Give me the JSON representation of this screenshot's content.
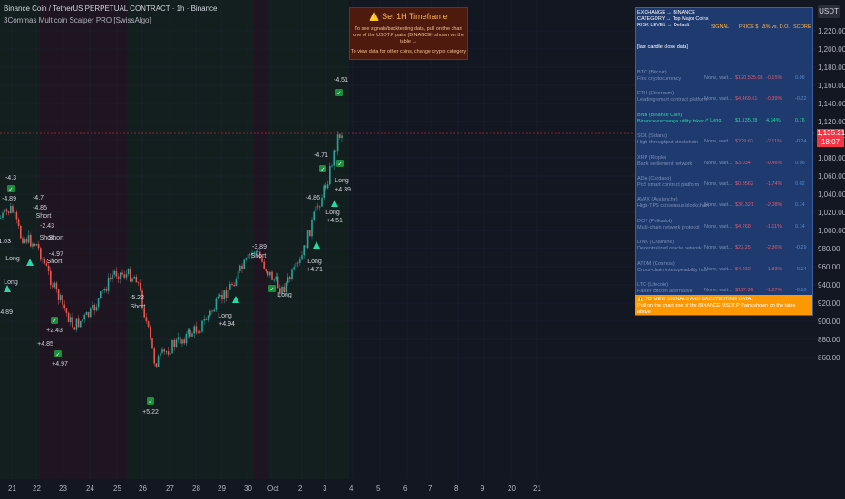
{
  "header": {
    "symbol": "Binance Coin / TetherUS PERPETUAL CONTRACT · 1h · Binance",
    "indicator": "3Commas Multicoin Scalper PRO [SwissAlgo]"
  },
  "banner": {
    "title": "⚠️ Set 1H Timeframe",
    "line1": "To see signals/backtesting data, pull on the chart",
    "line2": "one of the USDT.P pairs (BINANCE) shown on the table →",
    "line3": "To view data for other coins, change crypto category"
  },
  "price_axis": {
    "quote": "USDT",
    "labels": [
      "1,220.00",
      "1,200.00",
      "1,180.00",
      "1,160.00",
      "1,140.00",
      "1,120.00",
      "1,100.00",
      "1,080.00",
      "1,060.00",
      "1,040.00",
      "1,020.00",
      "1,000.00",
      "980.00",
      "960.00",
      "940.00",
      "920.00",
      "900.00",
      "880.00",
      "860.00"
    ],
    "current_price": "1,135.21",
    "countdown": "18:07"
  },
  "time_axis": [
    "21",
    "22",
    "23",
    "24",
    "25",
    "26",
    "27",
    "28",
    "29",
    "30",
    "Oct",
    "2",
    "3",
    "4",
    "5",
    "6",
    "7",
    "8",
    "9",
    "20",
    "21"
  ],
  "panel": {
    "exchange": "EXCHANGE → BINANCE",
    "category": "CATEGORY → Top Major Coins",
    "risk": "RISK LEVEL → Default",
    "col_signal": "SIGNAL",
    "col_price": "PRICE $",
    "col_dd": "Δ% vs. D.O.",
    "col_score": "SCORE",
    "last_close": "[last candle close data]",
    "rows": [
      {
        "name": "BTC (Bitcoin)",
        "desc": "First cryptocurrency",
        "signal": "None, wait...",
        "price": "$120,535.08",
        "dd": "-0.15%",
        "score": "0.06"
      },
      {
        "name": "ETH (Ethereum)",
        "desc": "Leading smart contract platform",
        "signal": "None, wait...",
        "price": "$4,469.61",
        "dd": "-0.39%",
        "score": "-0.22"
      },
      {
        "name": "BNB (Binance Coin)",
        "desc": "Binance exchange utility token",
        "signal": "↗ Long",
        "price": "$1,135.28",
        "dd": "4.34%",
        "score": "0.76"
      },
      {
        "name": "SOL (Solana)",
        "desc": "High-throughput blockchain",
        "signal": "None, wait...",
        "price": "$229.62",
        "dd": "-2.11%",
        "score": "-0.24"
      },
      {
        "name": "XRP (Ripple)",
        "desc": "Bank settlement network",
        "signal": "None, wait...",
        "price": "$3.034",
        "dd": "-0.46%",
        "score": "0.06"
      },
      {
        "name": "ADA (Cardano)",
        "desc": "PoS smart contract platform",
        "signal": "None, wait...",
        "price": "$0.8562",
        "dd": "-1.74%",
        "score": "0.02"
      },
      {
        "name": "AVAX (Avalanche)",
        "desc": "High-TPS consensus blockchain",
        "signal": "None, wait...",
        "price": "$30.321",
        "dd": "-2.08%",
        "score": "0.14"
      },
      {
        "name": "DOT (Polkadot)",
        "desc": "Multi-chain network protocol",
        "signal": "None, wait...",
        "price": "$4.268",
        "dd": "-1.11%",
        "score": "0.14"
      },
      {
        "name": "LINK (Chainlink)",
        "desc": "Decentralized oracle network",
        "signal": "None, wait...",
        "price": "$22.25",
        "dd": "-2.36%",
        "score": "-0.29"
      },
      {
        "name": "ATOM (Cosmos)",
        "desc": "Cross-chain interoperability hub",
        "signal": "None, wait...",
        "price": "$4.232",
        "dd": "-1.83%",
        "score": "-0.14"
      },
      {
        "name": "LTC (Litecoin)",
        "desc": "Faster Bitcoin alternative",
        "signal": "None, wait...",
        "price": "$117.36",
        "dd": "-1.27%",
        "score": "-0.10"
      }
    ],
    "notice1": "⚠️ TO VIEW SIGNALS AND BACKTESTING DATA:",
    "notice2": "Pull on the chart one of the BINANCE USDT.P Pairs shown on the table above"
  },
  "signals": {
    "long": "Long",
    "short": "Short",
    "values": [
      "-4.3",
      "-4.89",
      "-4.7",
      "-4.85",
      "-2.43",
      "+2.43",
      "+4.85",
      "+4.97",
      "-4.97",
      "-5.22",
      "+5.22",
      "+4.94",
      "-3.89",
      "+4.71",
      "-4.71",
      "-4.86",
      "+4.51",
      "-4.51",
      "+4.39",
      "-1.03"
    ]
  },
  "colors": {
    "up": "#26a69a",
    "down": "#ef5350",
    "bg": "#131722",
    "long": "#26d9a6",
    "short": "#e040fb"
  }
}
